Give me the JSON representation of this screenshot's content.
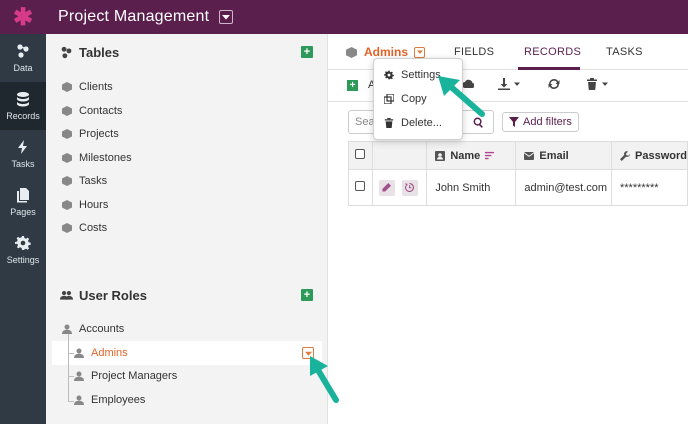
{
  "app": {
    "title": "Project Management",
    "accent_color": "#5a1f4d",
    "highlight_color": "#e0632a",
    "annotation_color": "#19b39b"
  },
  "rail": {
    "items": [
      {
        "label": "Data",
        "icon": "database-graph-icon"
      },
      {
        "label": "Records",
        "icon": "database-icon"
      },
      {
        "label": "Tasks",
        "icon": "lightning-icon"
      },
      {
        "label": "Pages",
        "icon": "pages-icon"
      },
      {
        "label": "Settings",
        "icon": "gear-icon"
      }
    ]
  },
  "sidebar": {
    "tables_title": "Tables",
    "tables": [
      "Clients",
      "Contacts",
      "Projects",
      "Milestones",
      "Tasks",
      "Hours",
      "Costs"
    ],
    "roles_title": "User Roles",
    "roles": [
      "Accounts",
      "Admins",
      "Project Managers",
      "Employees"
    ]
  },
  "main": {
    "current": "Admins",
    "tabs": [
      "FIELDS",
      "RECORDS",
      "TASKS"
    ],
    "active_tab": "RECORDS",
    "toolbar_partial": "A",
    "search_placeholder": "Sea",
    "filters_label": "Add filters",
    "columns": [
      "Name",
      "Email",
      "Password"
    ],
    "rows": [
      {
        "name": "John Smith",
        "email": "admin@test.com",
        "password": "*********"
      }
    ]
  },
  "menu": {
    "items": [
      "Settings",
      "Copy",
      "Delete..."
    ]
  }
}
